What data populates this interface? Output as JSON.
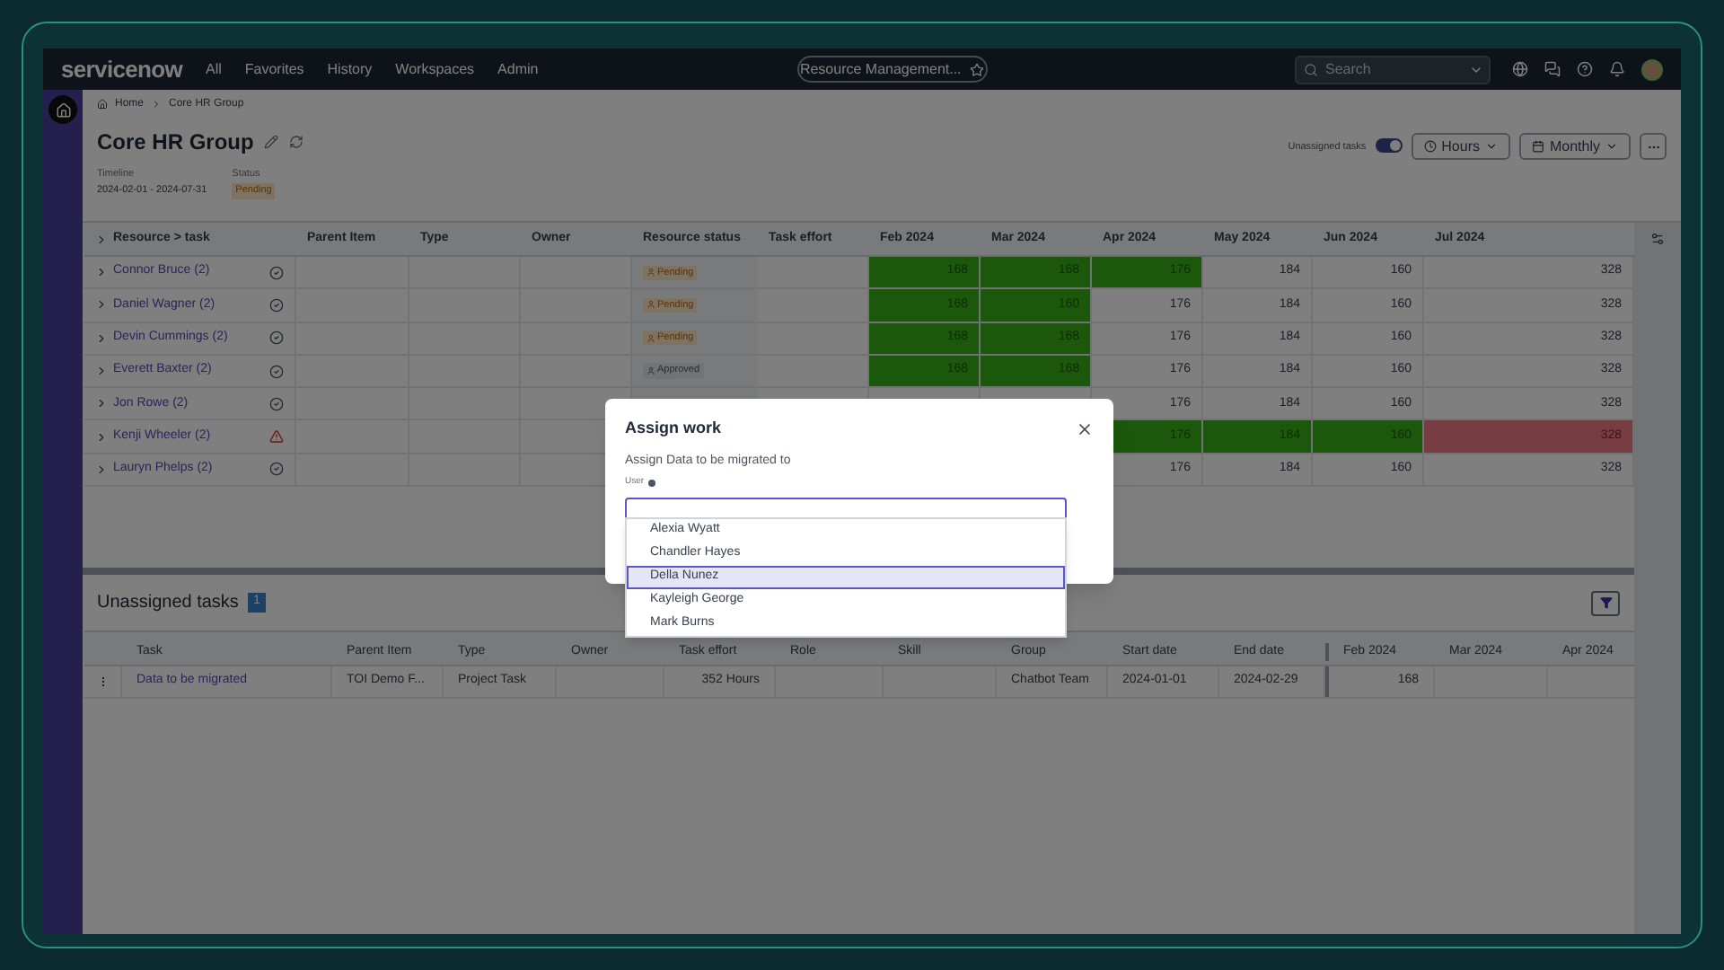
{
  "nav": {
    "logo": "servicenow",
    "menu": [
      {
        "label": "All"
      },
      {
        "label": "Favorites"
      },
      {
        "label": "History"
      },
      {
        "label": "Workspaces"
      },
      {
        "label": "Admin"
      }
    ],
    "app_tab": "Resource Management...",
    "search": {
      "placeholder": "Search"
    }
  },
  "breadcrumb": [
    {
      "label": "Home"
    },
    {
      "label": "Core HR Group"
    }
  ],
  "header": {
    "title": "Core HR Group",
    "timeline_label": "Timeline",
    "timeline": "2024-02-01 - 2024-07-31",
    "status_label": "Status",
    "status": "Pending",
    "unassigned_toggle": {
      "label": "Unassigned tasks",
      "on": true
    },
    "hours_button": "Hours",
    "monthly_button": "Monthly"
  },
  "resource_table": {
    "columns": [
      "Resource > task",
      "Parent Item",
      "Type",
      "Owner",
      "Resource status",
      "Task effort",
      "Feb 2024",
      "Mar 2024",
      "Apr 2024",
      "May 2024",
      "Jun 2024",
      "Jul 2024"
    ],
    "rows": [
      {
        "name": "Connor Bruce (2)",
        "alert": false,
        "status": {
          "label": "Pending",
          "kind": "pending"
        },
        "months": [
          {
            "value": "168",
            "kind": "full"
          },
          {
            "value": "168",
            "kind": "full"
          },
          {
            "value": "176",
            "kind": "full"
          },
          {
            "value": "184",
            "kind": "open"
          },
          {
            "value": "160",
            "kind": "open"
          },
          {
            "value": "328",
            "kind": "open"
          }
        ]
      },
      {
        "name": "Daniel Wagner (2)",
        "alert": false,
        "status": {
          "label": "Pending",
          "kind": "pending"
        },
        "months": [
          {
            "value": "168",
            "kind": "full"
          },
          {
            "value": "160",
            "kind": "full"
          },
          {
            "value": "176",
            "kind": "open"
          },
          {
            "value": "184",
            "kind": "open"
          },
          {
            "value": "160",
            "kind": "open"
          },
          {
            "value": "328",
            "kind": "open"
          }
        ]
      },
      {
        "name": "Devin Cummings (2)",
        "alert": false,
        "status": {
          "label": "Pending",
          "kind": "pending"
        },
        "months": [
          {
            "value": "168",
            "kind": "full"
          },
          {
            "value": "168",
            "kind": "full"
          },
          {
            "value": "176",
            "kind": "open"
          },
          {
            "value": "184",
            "kind": "open"
          },
          {
            "value": "160",
            "kind": "open"
          },
          {
            "value": "328",
            "kind": "open"
          }
        ]
      },
      {
        "name": "Everett Baxter (2)",
        "alert": false,
        "status": {
          "label": "Approved",
          "kind": "approved"
        },
        "months": [
          {
            "value": "168",
            "kind": "full"
          },
          {
            "value": "168",
            "kind": "full"
          },
          {
            "value": "176",
            "kind": "open"
          },
          {
            "value": "184",
            "kind": "open"
          },
          {
            "value": "160",
            "kind": "open"
          },
          {
            "value": "328",
            "kind": "open"
          }
        ]
      },
      {
        "name": "Jon Rowe (2)",
        "alert": false,
        "months": [
          {
            "value": "176",
            "kind": "open"
          },
          {
            "value": "184",
            "kind": "open"
          },
          {
            "value": "160",
            "kind": "open"
          },
          {
            "value": "328",
            "kind": "open"
          }
        ]
      },
      {
        "name": "Kenji Wheeler (2)",
        "alert": true,
        "months": [
          {
            "value": "176",
            "kind": "full"
          },
          {
            "value": "184",
            "kind": "full"
          },
          {
            "value": "160",
            "kind": "full"
          },
          {
            "value": "328",
            "kind": "over"
          }
        ]
      },
      {
        "name": "Lauryn Phelps (2)",
        "alert": false,
        "months": [
          {
            "value": "176",
            "kind": "open"
          },
          {
            "value": "184",
            "kind": "open"
          },
          {
            "value": "160",
            "kind": "open"
          },
          {
            "value": "328",
            "kind": "open"
          }
        ]
      }
    ]
  },
  "unassigned": {
    "title": "Unassigned tasks",
    "count": "1",
    "columns": [
      "Task",
      "Parent Item",
      "Type",
      "Owner",
      "Task effort",
      "Role",
      "Skill",
      "Group",
      "Start date",
      "End date",
      "Feb 2024",
      "Mar 2024",
      "Apr 2024"
    ],
    "rows": [
      {
        "task": "Data to be migrated",
        "parent_item": "TOI Demo F...",
        "type": "Project Task",
        "task_effort": "352 Hours",
        "group": "Chatbot Team",
        "start_date": "2024-01-01",
        "end_date": "2024-02-29",
        "feb": "168"
      }
    ]
  },
  "dialog": {
    "title": "Assign work",
    "text": "Assign Data to be migrated to",
    "field_label": "User",
    "required": true,
    "options": [
      {
        "label": "Alexia Wyatt",
        "selected": false
      },
      {
        "label": "Chandler Hayes",
        "selected": false
      },
      {
        "label": "Della Nunez",
        "selected": true
      },
      {
        "label": "Kayleigh George",
        "selected": false
      },
      {
        "label": "Mark Burns",
        "selected": false
      }
    ]
  }
}
